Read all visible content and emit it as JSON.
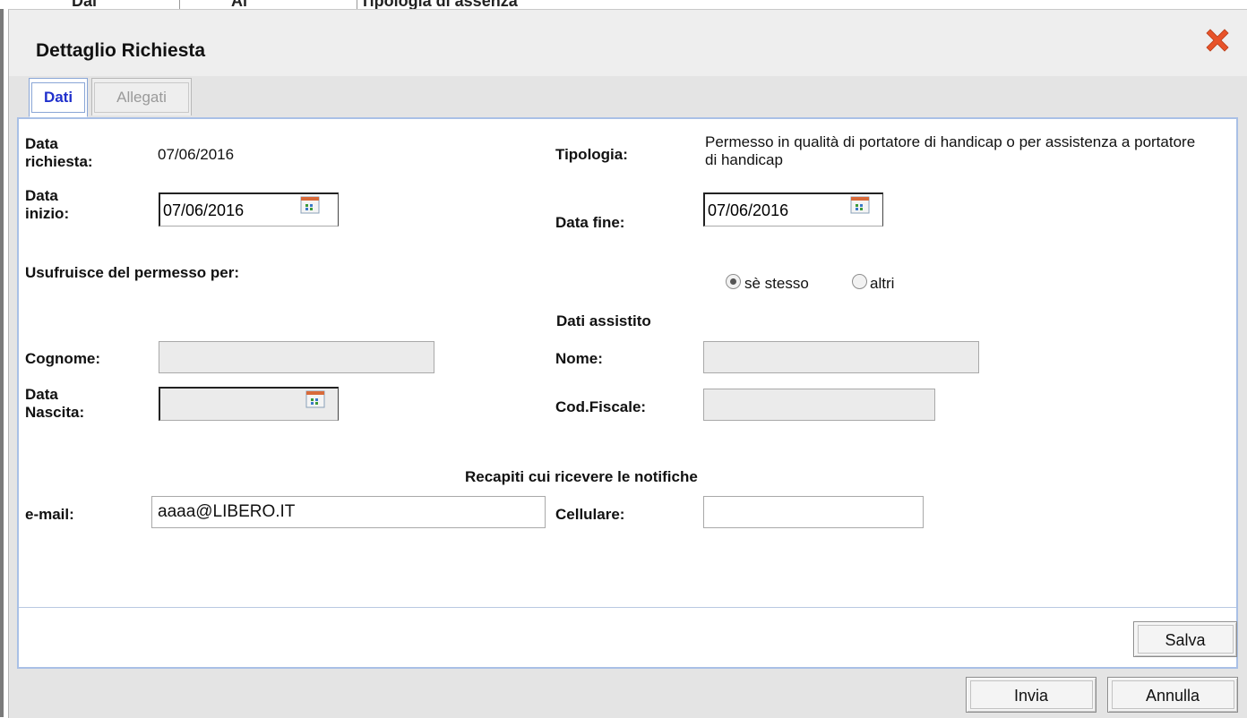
{
  "background": {
    "col_dal": "Dal",
    "col_al": "Al",
    "col_tipologia": "Tipologia di assenza"
  },
  "dialog": {
    "title": "Dettaglio Richiesta",
    "close_icon": "close-icon",
    "close_color": "#e8532a"
  },
  "tabs": [
    {
      "label": "Dati",
      "active": true
    },
    {
      "label": "Allegati",
      "active": false
    }
  ],
  "form": {
    "data_richiesta_label": "Data richiesta:",
    "data_richiesta_value": "07/06/2016",
    "tipologia_label": "Tipologia:",
    "tipologia_value": "Permesso in qualità di portatore di handicap o per assistenza a portatore di handicap",
    "data_inizio_label": "Data inizio:",
    "data_inizio_value": "07/06/2016",
    "data_fine_label": "Data fine:",
    "data_fine_value": "07/06/2016",
    "usufruisce_label": "Usufruisce del permesso per:",
    "radio_se_stesso": "sè stesso",
    "radio_altri": "altri",
    "radio_selected": "sè stesso",
    "dati_assistito_heading": "Dati assistito",
    "cognome_label": "Cognome:",
    "cognome_value": "",
    "nome_label": "Nome:",
    "nome_value": "",
    "data_nascita_label": "Data Nascita:",
    "data_nascita_value": "",
    "cod_fiscale_label": "Cod.Fiscale:",
    "cod_fiscale_value": "",
    "recapiti_heading": "Recapiti cui ricevere le notifiche",
    "email_label": "e-mail:",
    "email_value": "aaaa@LIBERO.IT",
    "cellulare_label": "Cellulare:",
    "cellulare_value": ""
  },
  "buttons": {
    "salva": "Salva",
    "invia": "Invia",
    "annulla": "Annulla"
  },
  "colors": {
    "accent_tab": "#2030cc",
    "panel_border": "#a9c0e6"
  }
}
